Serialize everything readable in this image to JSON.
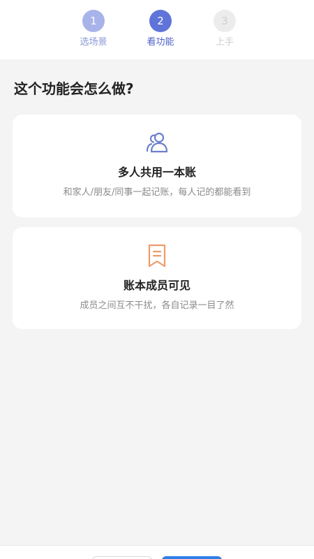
{
  "stepper": {
    "steps": [
      {
        "number": "1",
        "label": "选场景"
      },
      {
        "number": "2",
        "label": "看功能"
      },
      {
        "number": "3",
        "label": "上手"
      }
    ]
  },
  "question": "这个功能会怎么做?",
  "cards": [
    {
      "icon": "people-icon",
      "title": "多人共用一本账",
      "description": "和家人/朋友/同事一起记账，每人记的都能看到"
    },
    {
      "icon": "bookmark-icon",
      "title": "账本成员可见",
      "description": "成员之间互不干扰，各自记录一目了然"
    }
  ],
  "colors": {
    "step_done": "#a8b3ea",
    "step_active": "#5f74d9",
    "step_pending": "#ececec",
    "icon_blue": "#6b7fc9",
    "icon_orange": "#ee9a6a",
    "primary_button": "#2f7fe8"
  }
}
